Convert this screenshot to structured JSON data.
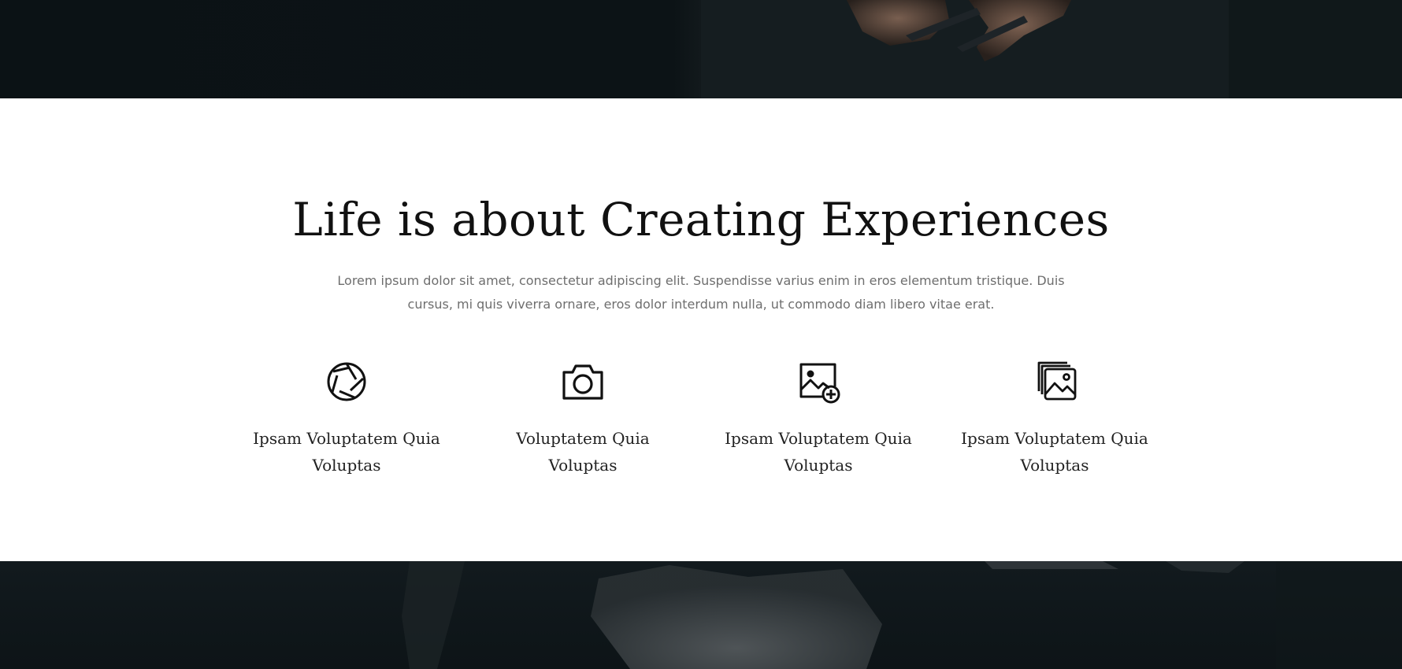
{
  "hero_top": {
    "image": "hands-holding-camera-photo"
  },
  "section": {
    "heading": "Life is about Creating Experiences",
    "description": "Lorem ipsum dolor sit amet, consectetur adipiscing elit. Suspendisse varius enim in eros elementum tristique. Duis cursus, mi quis viverra ornare, eros dolor interdum nulla, ut commodo diam libero vitae erat.",
    "features": [
      {
        "icon": "aperture-icon",
        "title": "Ipsam Voluptatem Quia Voluptas"
      },
      {
        "icon": "camera-icon",
        "title": "Voluptatem Quia Voluptas"
      },
      {
        "icon": "image-add-icon",
        "title": "Ipsam Voluptatem Quia Voluptas"
      },
      {
        "icon": "image-stack-icon",
        "title": "Ipsam Voluptatem Quia Voluptas"
      }
    ]
  },
  "hero_bottom": {
    "image": "dark-photo-background"
  },
  "colors": {
    "dark_band": "#0b1215",
    "heading": "#111111",
    "body_text": "#6e6e6e",
    "icon": "#111111"
  }
}
